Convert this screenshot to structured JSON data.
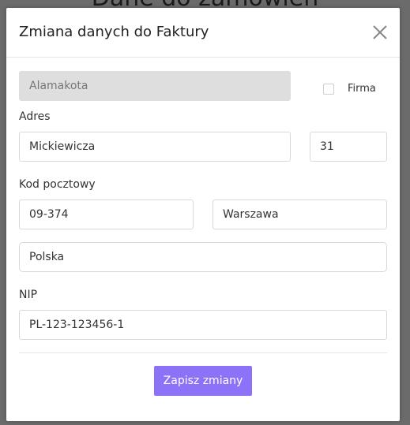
{
  "background": {
    "title": "Dane do zamówień"
  },
  "modal": {
    "title": "Zmiana danych do Faktury",
    "close_icon": "close-icon",
    "name": {
      "value": "Alamakota",
      "disabled": true
    },
    "company": {
      "label": "Firma",
      "checked": false
    },
    "address": {
      "label": "Adres",
      "street": "Mickiewicza",
      "number": "31"
    },
    "postal": {
      "label": "Kod pocztowy",
      "code": "09-374",
      "city": "Warszawa"
    },
    "country": "Polska",
    "nip": {
      "label": "NIP",
      "value": "PL-123-123456-1"
    },
    "submit_label": "Zapisz zmiany"
  },
  "colors": {
    "accent": "#8c72f7",
    "backdrop": "#6b6b6b",
    "disabled_field": "#dedede"
  }
}
